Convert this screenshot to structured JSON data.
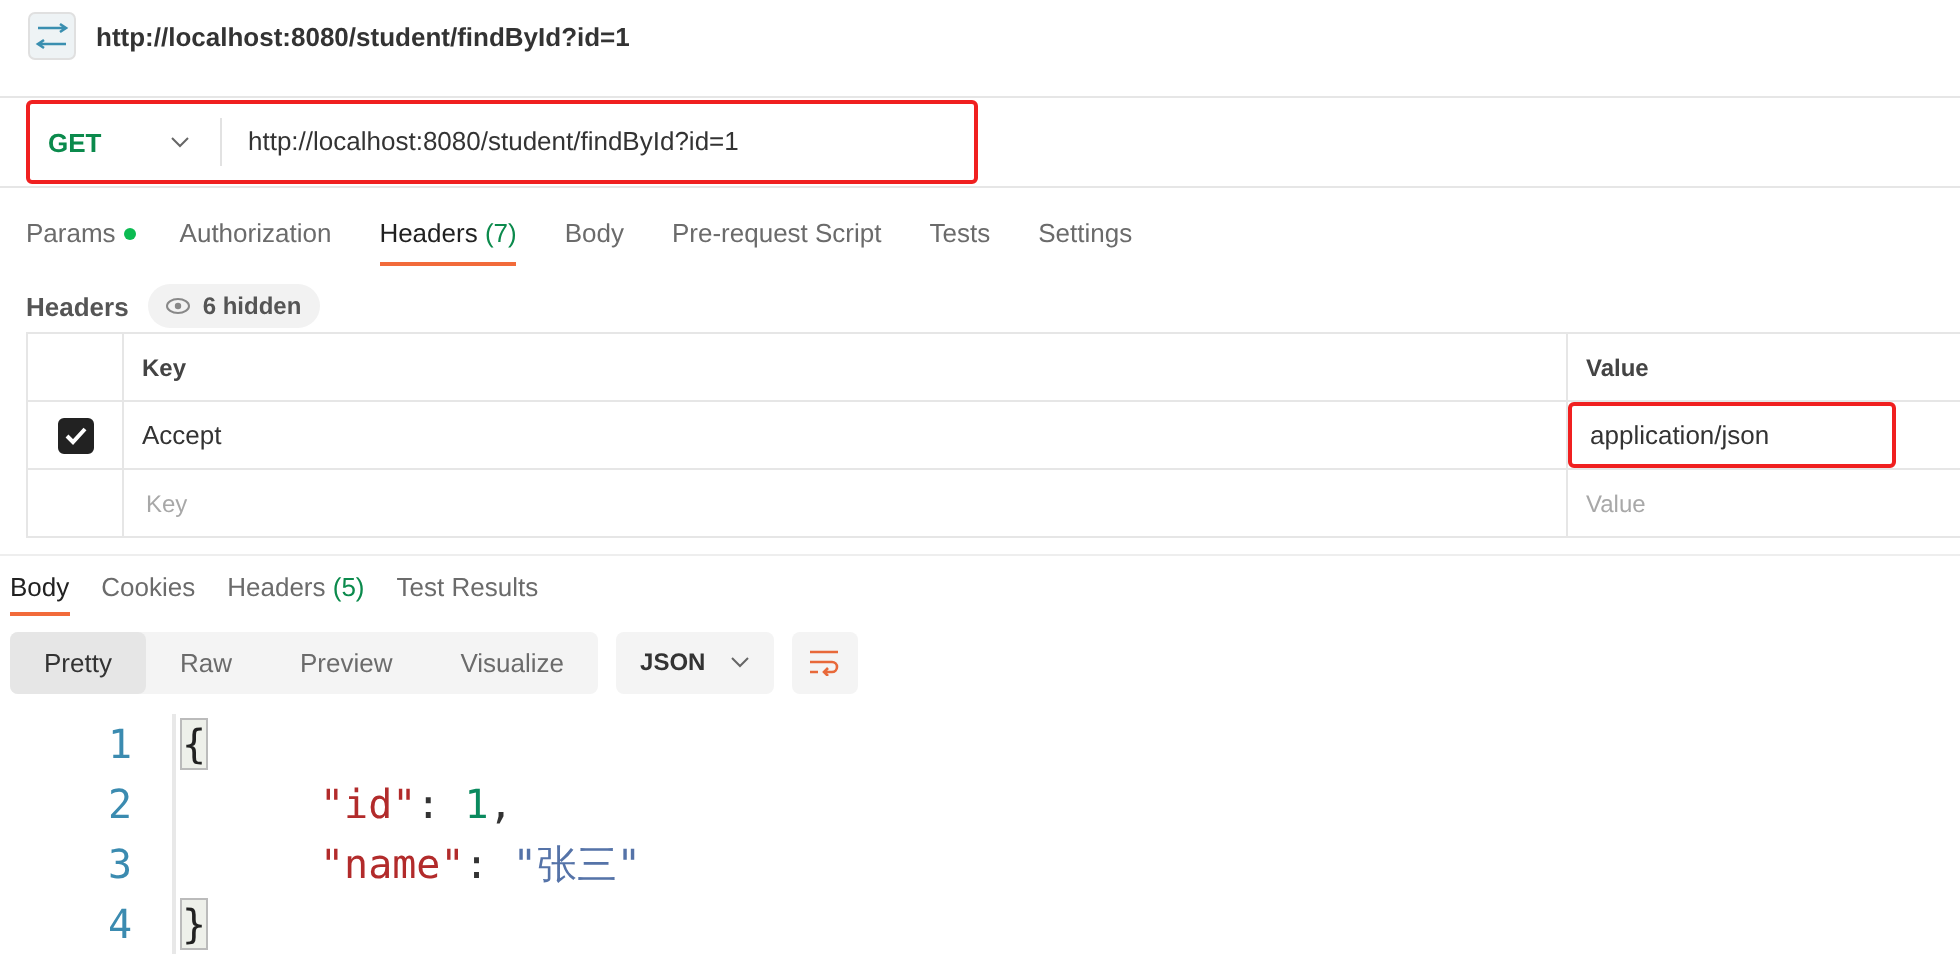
{
  "request_title": "http://localhost:8080/student/findById?id=1",
  "request_bar": {
    "method": "GET",
    "url": "http://localhost:8080/student/findById?id=1",
    "highlighted": true
  },
  "request_tabs": [
    {
      "label": "Params",
      "dot": true,
      "selected": false
    },
    {
      "label": "Authorization",
      "dot": false,
      "selected": false
    },
    {
      "label": "Headers",
      "count": "(7)",
      "dot": false,
      "selected": true
    },
    {
      "label": "Body",
      "dot": false,
      "selected": false
    },
    {
      "label": "Pre-request Script",
      "dot": false,
      "selected": false
    },
    {
      "label": "Tests",
      "dot": false,
      "selected": false
    },
    {
      "label": "Settings",
      "dot": false,
      "selected": false
    }
  ],
  "headers_bar": {
    "label": "Headers",
    "hidden": "6 hidden"
  },
  "headers_table": {
    "columns": [
      "Key",
      "Value"
    ],
    "rows": [
      {
        "checked": true,
        "key": "Accept",
        "value": "application/json",
        "highlighted": true
      }
    ],
    "new_row": {
      "key_placeholder": "Key",
      "value_placeholder": "Value"
    }
  },
  "response_tabs": [
    {
      "label": "Body",
      "selected": true
    },
    {
      "label": "Cookies",
      "selected": false
    },
    {
      "label": "Headers",
      "count": "(5)",
      "selected": false
    },
    {
      "label": "Test Results",
      "selected": false
    }
  ],
  "view_modes": [
    {
      "label": "Pretty",
      "selected": true
    },
    {
      "label": "Raw",
      "selected": false
    },
    {
      "label": "Preview",
      "selected": false
    },
    {
      "label": "Visualize",
      "selected": false
    }
  ],
  "format": "JSON",
  "code_lines": [
    {
      "number": "1",
      "indent": false,
      "tokens": [
        {
          "kind": "brace",
          "text": "{"
        }
      ]
    },
    {
      "number": "2",
      "indent": true,
      "tokens": [
        {
          "kind": "key",
          "text": "\"id\""
        },
        {
          "kind": "punct",
          "text": ": "
        },
        {
          "kind": "number",
          "text": "1"
        },
        {
          "kind": "punct",
          "text": ","
        }
      ]
    },
    {
      "number": "3",
      "indent": true,
      "tokens": [
        {
          "kind": "key",
          "text": "\"name\""
        },
        {
          "kind": "punct",
          "text": ": "
        },
        {
          "kind": "string",
          "text": "\"张三\""
        }
      ]
    },
    {
      "number": "4",
      "indent": false,
      "tokens": [
        {
          "kind": "brace",
          "text": "}"
        }
      ]
    }
  ]
}
